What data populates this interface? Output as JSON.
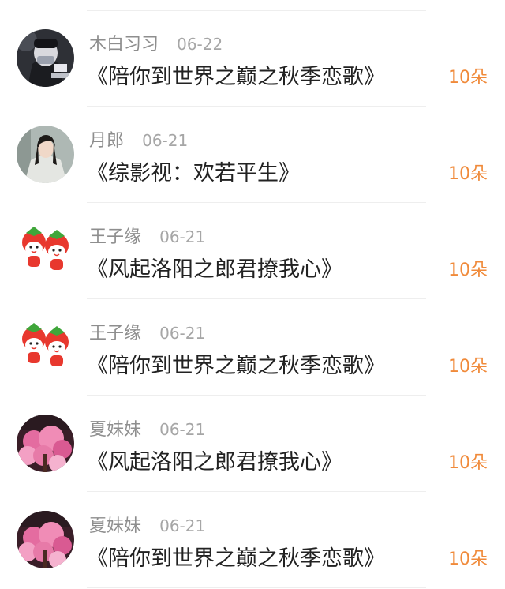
{
  "colors": {
    "count": "#f08a3a",
    "name": "#8e8e8e",
    "date": "#a6a6a6",
    "title": "#222222"
  },
  "items": [
    {
      "user": "木白习习",
      "date": "06-22",
      "title": "《陪你到世界之巅之秋季恋歌》",
      "count": "10朵",
      "avatar": "dark-masked-figure"
    },
    {
      "user": "月郎",
      "date": "06-21",
      "title": "《综影视：欢若平生》",
      "count": "10朵",
      "avatar": "man-in-white-robes"
    },
    {
      "user": "王子缘",
      "date": "06-21",
      "title": "《风起洛阳之郎君撩我心》",
      "count": "10朵",
      "avatar": "strawberry-cartoon"
    },
    {
      "user": "王子缘",
      "date": "06-21",
      "title": "《陪你到世界之巅之秋季恋歌》",
      "count": "10朵",
      "avatar": "strawberry-cartoon"
    },
    {
      "user": "夏妹妹",
      "date": "06-21",
      "title": "《风起洛阳之郎君撩我心》",
      "count": "10朵",
      "avatar": "pink-blossom-tree"
    },
    {
      "user": "夏妹妹",
      "date": "06-21",
      "title": "《陪你到世界之巅之秋季恋歌》",
      "count": "10朵",
      "avatar": "pink-blossom-tree"
    }
  ]
}
